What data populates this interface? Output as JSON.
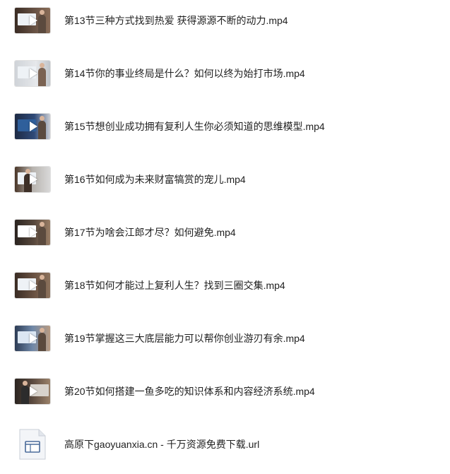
{
  "files": [
    {
      "name": "第13节三种方式找到热爱 获得源源不断的动力.mp4",
      "type": "video",
      "icon": "video-thumbnail-icon"
    },
    {
      "name": "第14节你的事业终局是什么？如何以终为始打市场.mp4",
      "type": "video",
      "icon": "video-thumbnail-icon"
    },
    {
      "name": "第15节想创业成功拥有复利人生你必须知道的思维模型.mp4",
      "type": "video",
      "icon": "video-thumbnail-icon"
    },
    {
      "name": "第16节如何成为未来财富犒赏的宠儿.mp4",
      "type": "video",
      "icon": "video-thumbnail-icon"
    },
    {
      "name": "第17节为啥会江郎才尽？如何避免.mp4",
      "type": "video",
      "icon": "video-thumbnail-icon"
    },
    {
      "name": "第18节如何才能过上复利人生？找到三圈交集.mp4",
      "type": "video",
      "icon": "video-thumbnail-icon"
    },
    {
      "name": "第19节掌握这三大底层能力可以帮你创业游刃有余.mp4",
      "type": "video",
      "icon": "video-thumbnail-icon"
    },
    {
      "name": "第20节如何搭建一鱼多吃的知识体系和内容经济系统.mp4",
      "type": "video",
      "icon": "video-thumbnail-icon"
    },
    {
      "name": "高原下gaoyuanxia.cn - 千万资源免费下载.url",
      "type": "url",
      "icon": "url-file-icon"
    }
  ]
}
